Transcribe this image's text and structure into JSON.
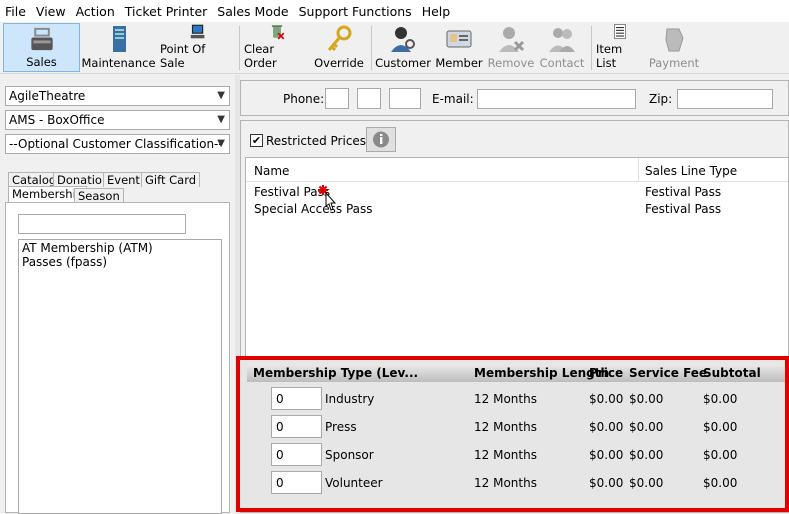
{
  "menu": [
    "File",
    "View",
    "Action",
    "Ticket Printer",
    "Sales Mode",
    "Support Functions",
    "Help"
  ],
  "toolbar": {
    "sales": "Sales",
    "maintenance": "Maintenance",
    "point_of_sale": "Point Of Sale",
    "clear_order": "Clear Order",
    "override": "Override",
    "customer": "Customer",
    "member": "Member",
    "remove": "Remove",
    "contact": "Contact",
    "item_list": "Item List",
    "payment": "Payment"
  },
  "left": {
    "organization": "AgileTheatre",
    "location": "AMS - BoxOffice",
    "classification": "--Optional Customer Classification--",
    "tabs": [
      "Catalog",
      "Donation",
      "Event",
      "Gift Card",
      "Membership",
      "Season"
    ],
    "search_value": "",
    "list": [
      "AT Membership  (ATM)",
      "Passes  (fpass)"
    ]
  },
  "contact_bar": {
    "phone_label": "Phone:",
    "email_label": "E-mail:",
    "zip_label": "Zip:"
  },
  "restricted": {
    "label": "Restricted Prices",
    "checked": true
  },
  "items_table": {
    "headers": [
      "Name",
      "Sales Line Type"
    ],
    "rows": [
      {
        "name": "Festival Pass",
        "type": "Festival Pass"
      },
      {
        "name": "Special Access Pass",
        "type": "Festival Pass"
      }
    ]
  },
  "membership_table": {
    "headers": [
      "Membership Type (Lev...",
      "Membership Length",
      "Price",
      "Service Fee",
      "Subtotal"
    ],
    "rows": [
      {
        "qty": "0",
        "type": "Industry",
        "length": "12 Months",
        "price": "$0.00",
        "fee": "$0.00",
        "subtotal": "$0.00"
      },
      {
        "qty": "0",
        "type": "Press",
        "length": "12 Months",
        "price": "$0.00",
        "fee": "$0.00",
        "subtotal": "$0.00"
      },
      {
        "qty": "0",
        "type": "Sponsor",
        "length": "12 Months",
        "price": "$0.00",
        "fee": "$0.00",
        "subtotal": "$0.00"
      },
      {
        "qty": "0",
        "type": "Volunteer",
        "length": "12 Months",
        "price": "$0.00",
        "fee": "$0.00",
        "subtotal": "$0.00"
      }
    ]
  },
  "colors": {
    "highlight_border": "#e00000",
    "active_button": "#cde6fb",
    "header_bg": "#d4d4d4"
  }
}
